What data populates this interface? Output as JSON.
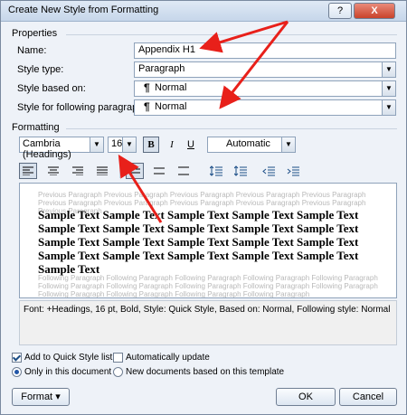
{
  "window": {
    "title": "Create New Style from Formatting",
    "help_label": "?",
    "close_label": "X"
  },
  "properties": {
    "section_label": "Properties",
    "name_label": "Name:",
    "name_value": "Appendix H1",
    "style_type_label": "Style type:",
    "style_type_value": "Paragraph",
    "based_on_label": "Style based on:",
    "based_on_value": "Normal",
    "following_label": "Style for following paragraph:",
    "following_value": "Normal"
  },
  "formatting": {
    "section_label": "Formatting",
    "font": "Cambria (Headings)",
    "size": "16",
    "bold": "B",
    "italic": "I",
    "underline": "U",
    "color": "Automatic"
  },
  "preview": {
    "previous_text": "Previous Paragraph Previous Paragraph Previous Paragraph Previous Paragraph Previous Paragraph Previous Paragraph Previous Paragraph Previous Paragraph Previous Paragraph Previous Paragraph Previous Paragraph",
    "sample_text": "Sample Text Sample Text Sample Text Sample Text Sample Text Sample Text Sample Text Sample Text Sample Text Sample Text Sample Text Sample Text Sample Text Sample Text Sample Text Sample Text Sample Text Sample Text Sample Text Sample Text Sample Text",
    "following_text": "Following Paragraph Following Paragraph Following Paragraph Following Paragraph Following Paragraph Following Paragraph Following Paragraph Following Paragraph Following Paragraph Following Paragraph Following Paragraph Following Paragraph Following Paragraph Following Paragraph"
  },
  "description": "Font: +Headings, 16 pt, Bold, Style: Quick Style, Based on: Normal, Following style: Normal",
  "options": {
    "add_quick_style": "Add to Quick Style list",
    "auto_update": "Automatically update",
    "only_doc": "Only in this document",
    "new_docs": "New documents based on this template"
  },
  "buttons": {
    "format": "Format",
    "format_arrow": "▾",
    "ok": "OK",
    "cancel": "Cancel"
  },
  "colors": {
    "annotation_arrow": "#e8201a"
  },
  "icons": {
    "paragraph": "¶",
    "dropdown": "▼"
  }
}
